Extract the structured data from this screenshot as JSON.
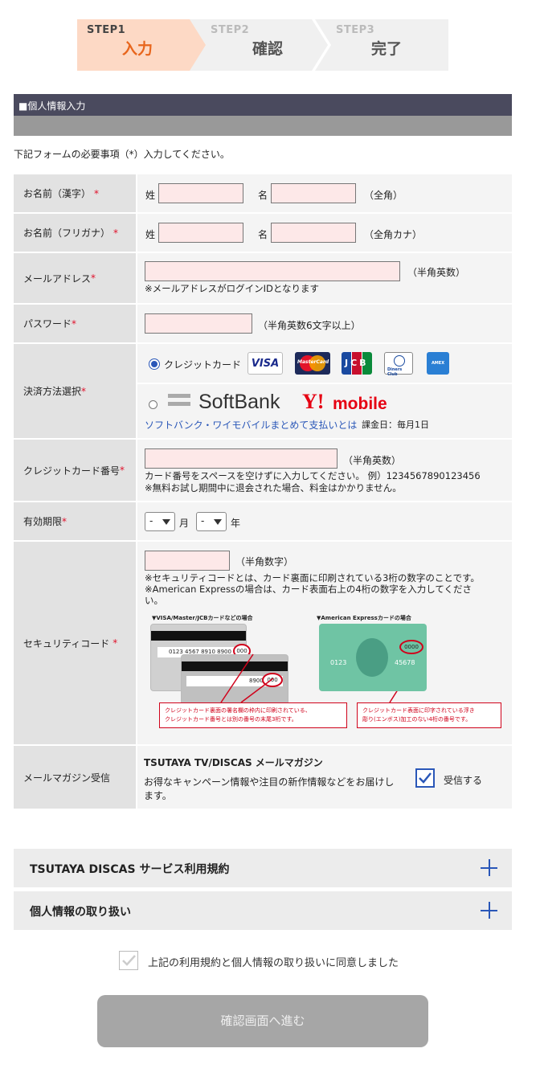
{
  "steps": [
    {
      "num": "STEP1",
      "label": "入力"
    },
    {
      "num": "STEP2",
      "label": "確認"
    },
    {
      "num": "STEP3",
      "label": "完了"
    }
  ],
  "section_title": "■個人情報入力",
  "intro": "下記フォームの必要事項（*）入力してください。",
  "required_mark": "*",
  "fields": {
    "name_kanji": {
      "label": "お名前（漢字）",
      "sei": "姓",
      "mei": "名",
      "note": "（全角）"
    },
    "name_kana": {
      "label": "お名前（フリガナ）",
      "sei": "姓",
      "mei": "名",
      "note": "（全角カナ）"
    },
    "email": {
      "label": "メールアドレス",
      "note": "（半角英数）",
      "help": "※メールアドレスがログインIDとなります"
    },
    "password": {
      "label": "パスワード",
      "note": "（半角英数6文字以上）"
    },
    "payment": {
      "label": "決済方法選択",
      "credit_label": "クレジットカード",
      "card_brands": [
        "VISA",
        "MasterCard",
        "JCB",
        "Diners Club",
        "AMERICAN EXPRESS"
      ],
      "softbank": "SoftBank",
      "ymobile_y": "Y!",
      "ymobile": "mobile",
      "softbank_link": "ソフトバンク・ワイモバイルまとめて支払いとは",
      "billing_date": "課金日：毎月1日"
    },
    "card_number": {
      "label": "クレジットカード番号",
      "note": "（半角英数）",
      "help1": "カード番号をスペースを空けずに入力してください。 例）1234567890123456",
      "help2": "※無料お試し期間中に退会された場合、料金はかかりません。"
    },
    "expiry": {
      "label": "有効期限",
      "month_value": "-",
      "month_unit": "月",
      "year_value": "-",
      "year_unit": "年"
    },
    "security": {
      "label": "セキュリティコード",
      "note": "（半角数字）",
      "help1": "※セキュリティコードとは、カード裏面に印刷されている3桁の数字のことです。",
      "help2": "※American Expressの場合は、カード表面右上の4桁の数字を入力してくださ",
      "help3": "い。",
      "img_title_visa": "▼VISA/Master/JCBカードなどの場合",
      "img_title_amex": "▼American Expressカードの場合",
      "visa_card_number": "0123 4567 8910 8900",
      "visa_code": "000",
      "visa_back_number": "8900",
      "visa_back_code": "000",
      "amex_number1": "0123",
      "amex_number2": "45678",
      "amex_code": "0000",
      "caption_visa1": "クレジットカード裏面の署名欄の枠内に印刷されている、",
      "caption_visa2": "クレジットカード番号とは別の番号の末尾3桁です。",
      "caption_amex1": "クレジットカード表面に印字されている浮き",
      "caption_amex2": "彫り(エンボス)加工のない4桁の番号です。"
    },
    "newsletter": {
      "label": "メールマガジン受信",
      "title": "TSUTAYA TV/DISCAS メールマガジン",
      "desc1": "お得なキャンペーン情報や注目の新作情報などをお届けし",
      "desc2": "ます。",
      "checkbox_label": "受信する",
      "checked": true
    }
  },
  "accordions": [
    {
      "label": "TSUTAYA DISCAS サービス利用規約"
    },
    {
      "label": "個人情報の取り扱い"
    }
  ],
  "agree_label": "上記の利用規約と個人情報の取り扱いに同意しました",
  "submit_label": "確認画面へ進む",
  "colors": {
    "accent_blue": "#2a57b8",
    "required": "#e0102a",
    "step_active": "#e8661d"
  }
}
